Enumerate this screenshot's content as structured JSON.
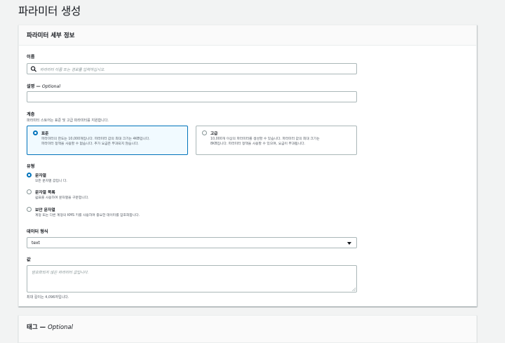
{
  "page": {
    "title": "파라미터 생성"
  },
  "details_panel": {
    "header": "파라미터 세부 정보"
  },
  "name_field": {
    "label": "이름",
    "placeholder": "파라미터 이름 또는 경로를 입력하십시오.",
    "icon": "search-icon"
  },
  "description_field": {
    "label": "설명 — ",
    "optional": "Optional",
    "value": ""
  },
  "tier": {
    "label": "계층",
    "description": "파라미터 스토어는 표준 및 고급 파라미터를 지원합니다.",
    "options": [
      {
        "title": "표준",
        "line1": "파라미터의 한도는 10,000개입니다. 파라미터 값의 최대 크기는 4KB입니다.",
        "line2": "파라미터 정책을 사용할 수 없습니다. 추가 요금은 부과되지 않습니다.",
        "selected": true
      },
      {
        "title": "고급",
        "line1": "10,000개 이상의 파라미터를 생성할 수 있습니다. 파라미터 값의 최대 크기는",
        "line2": "8KB입니다. 파라미터 정책을 사용할 수 있으며, 요금이 부과됩니다.",
        "selected": false
      }
    ]
  },
  "type": {
    "label": "유형",
    "options": [
      {
        "title": "문자열",
        "description": "모든 문자열 값입니 다.",
        "selected": true
      },
      {
        "title": "문자열 목록",
        "description": "쉼표를 사용하여 문자열을 구분합니다.",
        "selected": false
      },
      {
        "title": "보안 문자열",
        "description": "계정 또는 다른 계정의 KMS 키를 사용하여 중요한 데이터를 암호화합니다.",
        "selected": false
      }
    ]
  },
  "data_format": {
    "label": "데이터 형식",
    "selected": "text"
  },
  "value_field": {
    "label": "값",
    "placeholder": "암호화되지 않은 파라미터 값입니다.",
    "hint": "최대 길이는 4,096자입니다."
  },
  "tags_panel": {
    "header": "태그 — ",
    "optional": "Optional"
  },
  "colors": {
    "accent": "#0073bb",
    "selected_tile_bg": "#f1faff",
    "page_bg": "#f2f3f3"
  }
}
